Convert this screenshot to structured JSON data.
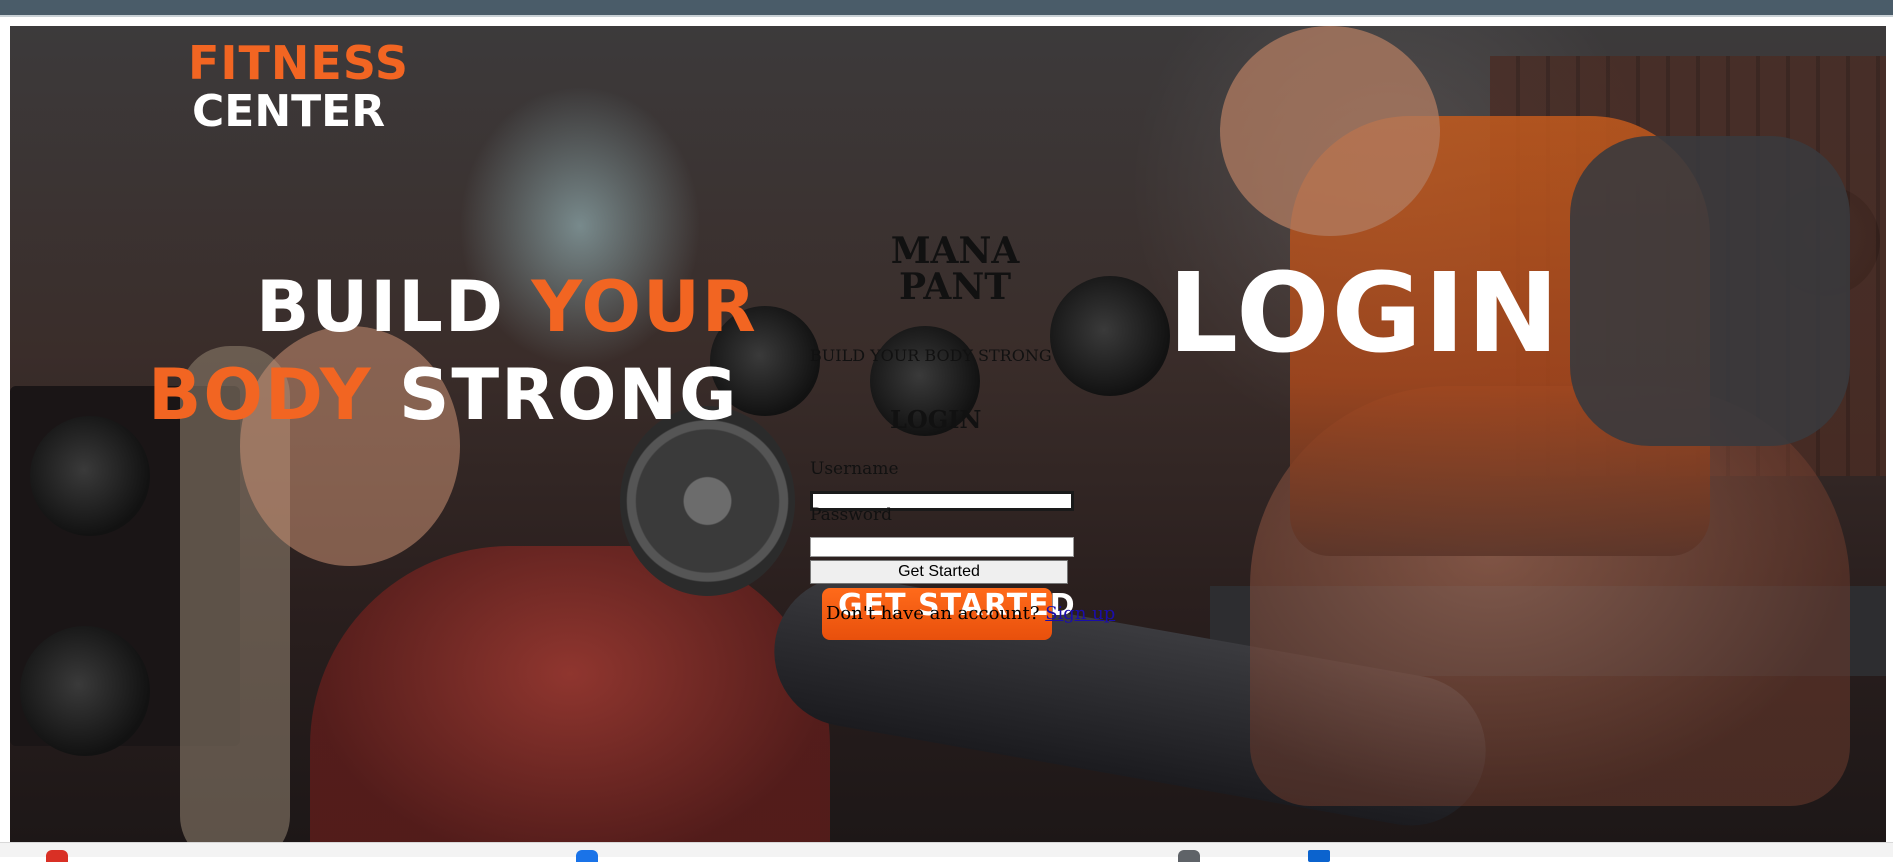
{
  "brand": {
    "line1": "FITNESS",
    "line2": "CENTER"
  },
  "slogan": {
    "w1": "BUILD",
    "o1": "YOUR",
    "o2": "BODY",
    "w2": "STRONG"
  },
  "hero_login": "LOGIN",
  "panel": {
    "title": "MANA PANT",
    "tagline": "Build your body strong",
    "heading": "LOGIN",
    "username_label": "Username",
    "username_value": "",
    "password_label": "Password",
    "password_value": "",
    "submit_label": "Get Started",
    "get_started_image_text": "GET STARTED",
    "signup_prompt": "Don't have an account?",
    "signup_link": "Sign up"
  },
  "colors": {
    "brand_orange": "#f26522",
    "top_bar": "#4a5c69",
    "link_blue": "#1a0dab"
  },
  "taskbar": {
    "icons": [
      {
        "name": "red-app-icon",
        "color": "#d93025"
      },
      {
        "name": "blue-app-icon",
        "color": "#1a73e8"
      },
      {
        "name": "gray-app-icon",
        "color": "#5f6368"
      },
      {
        "name": "blue-square-app-icon",
        "color": "#0b63ce"
      }
    ]
  }
}
